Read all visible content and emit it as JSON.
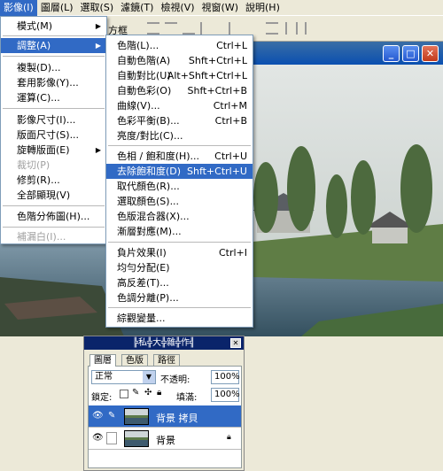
{
  "menubar": {
    "items": [
      {
        "label": "影像(I)",
        "active": true
      },
      {
        "label": "圖層(L)"
      },
      {
        "label": "選取(S)"
      },
      {
        "label": "濾鏡(T)"
      },
      {
        "label": "檢視(V)"
      },
      {
        "label": "視窗(W)"
      },
      {
        "label": "說明(H)"
      }
    ]
  },
  "options_bar": {
    "label": "方框"
  },
  "image_menu": {
    "items": [
      {
        "label": "模式(M)",
        "submenu": true
      },
      {
        "label": "調整(A)",
        "submenu": true,
        "highlighted": true
      },
      {
        "label": "複製(D)..."
      },
      {
        "label": "套用影像(Y)..."
      },
      {
        "label": "運算(C)..."
      },
      {
        "label": "影像尺寸(I)..."
      },
      {
        "label": "版面尺寸(S)..."
      },
      {
        "label": "旋轉版面(E)",
        "submenu": true
      },
      {
        "label": "裁切(P)",
        "disabled": true
      },
      {
        "label": "修剪(R)..."
      },
      {
        "label": "全部顯現(V)"
      },
      {
        "label": "色階分佈圖(H)..."
      },
      {
        "label": "補漏白(I)...",
        "disabled": true
      }
    ]
  },
  "adjust_menu": {
    "items": [
      {
        "label": "色階(L)...",
        "shortcut": "Ctrl+L"
      },
      {
        "label": "自動色階(A)",
        "shortcut": "Shft+Ctrl+L"
      },
      {
        "label": "自動對比(U)",
        "shortcut": "Alt+Shft+Ctrl+L"
      },
      {
        "label": "自動色彩(O)",
        "shortcut": "Shft+Ctrl+B"
      },
      {
        "label": "曲線(V)...",
        "shortcut": "Ctrl+M"
      },
      {
        "label": "色彩平衡(B)...",
        "shortcut": "Ctrl+B"
      },
      {
        "label": "亮度/對比(C)..."
      },
      {
        "label": "色相 / 飽和度(H)...",
        "shortcut": "Ctrl+U"
      },
      {
        "label": "去除飽和度(D)",
        "shortcut": "Shft+Ctrl+U",
        "highlighted": true
      },
      {
        "label": "取代顏色(R)..."
      },
      {
        "label": "選取顏色(S)..."
      },
      {
        "label": "色版混合器(X)..."
      },
      {
        "label": "漸層對應(M)..."
      },
      {
        "label": "負片效果(I)",
        "shortcut": "Ctrl+I"
      },
      {
        "label": "均勻分配(E)"
      },
      {
        "label": "高反差(T)..."
      },
      {
        "label": "色調分離(P)..."
      },
      {
        "label": "綜觀變量..."
      }
    ]
  },
  "layers_panel": {
    "title": "╠私╬大╬雜╬作╣",
    "tabs": [
      "圖層",
      "色版",
      "路徑"
    ],
    "blend_mode": "正常",
    "opacity_label": "不透明:",
    "opacity_value": "100%",
    "lock_label": "鎖定:",
    "fill_label": "填滿:",
    "fill_value": "100%",
    "layers": [
      {
        "name": "背景 拷貝",
        "selected": true
      },
      {
        "name": "背景",
        "locked": true
      }
    ]
  },
  "colors": {
    "highlight": "#316ac5",
    "menu_bg": "#ffffff",
    "titlebar": "#0a246a"
  }
}
